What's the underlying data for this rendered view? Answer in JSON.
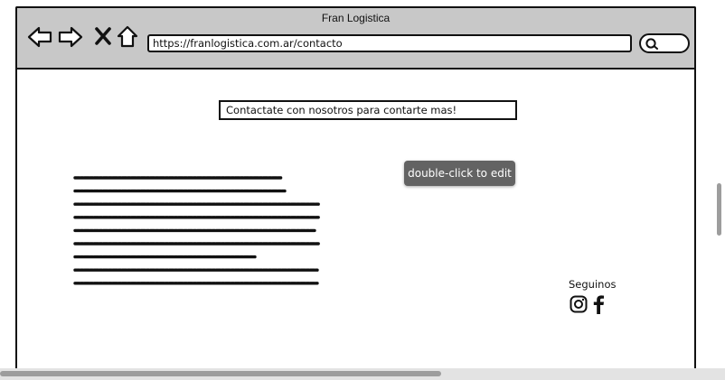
{
  "window": {
    "title": "Fran Logistica"
  },
  "browser": {
    "url": "https://franlogistica.com.ar/contacto",
    "icons": [
      "arrow-left-icon",
      "arrow-right-icon",
      "close-icon",
      "home-icon",
      "search-icon"
    ]
  },
  "page": {
    "heading": "Contactate con nosotros para contarte mas!",
    "tooltip": "double-click to edit",
    "social_label": "Seguinos",
    "social_icons": [
      "instagram-icon",
      "facebook-icon"
    ]
  },
  "colors": {
    "chrome": "#c8c8c8",
    "tooltip_bg": "#636363",
    "stroke": "#111111"
  }
}
